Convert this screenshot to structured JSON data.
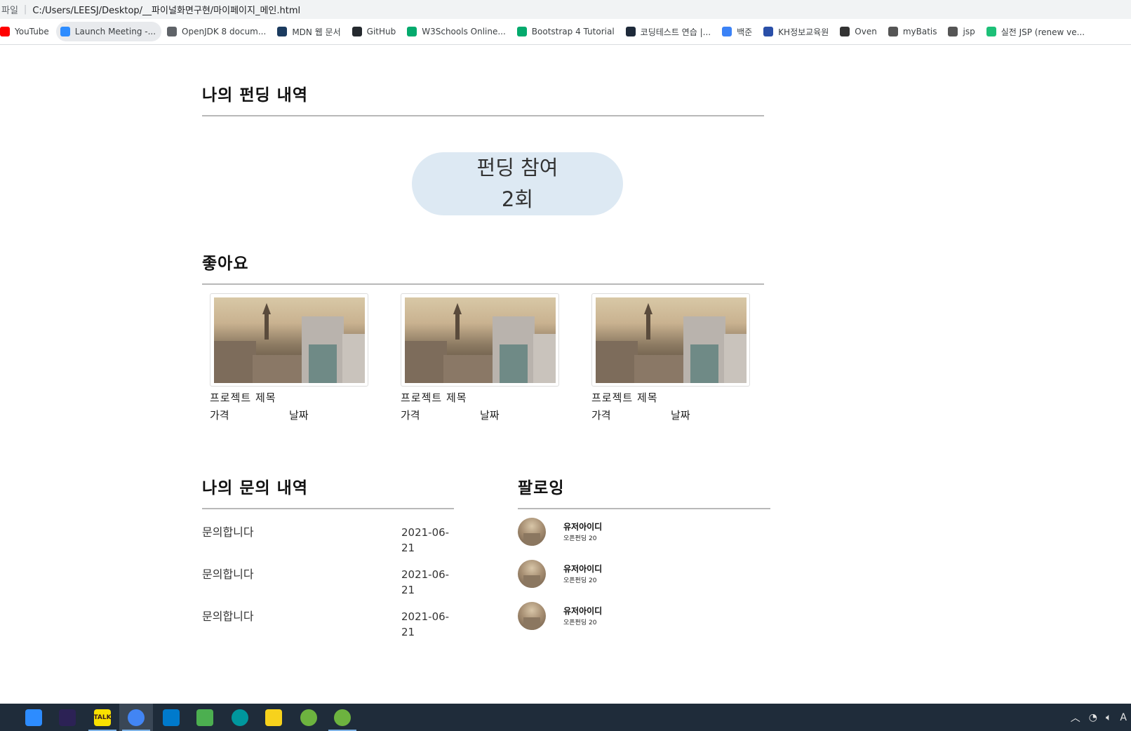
{
  "browser": {
    "address_scheme": "파일",
    "address_path": "C:/Users/LEESJ/Desktop/__파이널화면구현/마이페이지_메인.html",
    "bookmarks": [
      {
        "label": "YouTube",
        "icon": "youtube-icon",
        "color": "#ff0000"
      },
      {
        "label": "Launch Meeting -...",
        "icon": "zoom-icon",
        "color": "#2d8cff"
      },
      {
        "label": "OpenJDK 8 docum...",
        "icon": "search-doc-icon",
        "color": "#5f6368"
      },
      {
        "label": "MDN 웹 문서",
        "icon": "mdn-icon",
        "color": "#1b3b5f"
      },
      {
        "label": "GitHub",
        "icon": "github-icon",
        "color": "#24292e"
      },
      {
        "label": "W3Schools Online...",
        "icon": "w3schools-icon",
        "color": "#04aa6d"
      },
      {
        "label": "Bootstrap 4 Tutorial",
        "icon": "w3schools-icon",
        "color": "#04aa6d"
      },
      {
        "label": "코딩테스트 연습 |...",
        "icon": "programmers-icon",
        "color": "#1e2a3a"
      },
      {
        "label": "백준",
        "icon": "code-icon",
        "color": "#3b82f6"
      },
      {
        "label": "KH정보교육원",
        "icon": "kh-icon",
        "color": "#2a4fa8"
      },
      {
        "label": "Oven",
        "icon": "oven-icon",
        "color": "#333333"
      },
      {
        "label": "myBatis",
        "icon": "globe-icon",
        "color": "#555555"
      },
      {
        "label": "jsp",
        "icon": "globe-icon",
        "color": "#555555"
      },
      {
        "label": "실전 JSP (renew ve...",
        "icon": "inflearn-icon",
        "color": "#1dc078"
      }
    ]
  },
  "page": {
    "funding_title": "나의 펀딩 내역",
    "funding_pill": {
      "line1": "펀딩 참여",
      "line2": "2회"
    },
    "likes_title": "좋아요",
    "cards": [
      {
        "title": "프로젝트 제목",
        "price": "가격",
        "date": "날짜"
      },
      {
        "title": "프로젝트 제목",
        "price": "가격",
        "date": "날짜"
      },
      {
        "title": "프로젝트 제목",
        "price": "가격",
        "date": "날짜"
      }
    ],
    "inquiry_title": "나의 문의 내역",
    "inquiries": [
      {
        "text": "문의합니다",
        "date": "2021-06-21"
      },
      {
        "text": "문의합니다",
        "date": "2021-06-21"
      },
      {
        "text": "문의합니다",
        "date": "2021-06-21"
      }
    ],
    "following_title": "팔로잉",
    "following": [
      {
        "user_id": "유저아이디",
        "sub": "오픈펀딩 20"
      },
      {
        "user_id": "유저아이디",
        "sub": "오픈펀딩 20"
      },
      {
        "user_id": "유저아이디",
        "sub": "오픈펀딩 20"
      }
    ]
  },
  "taskbar": {
    "apps": [
      {
        "name": "zoom",
        "icon": "zoom-icon",
        "color": "#2d8cff"
      },
      {
        "name": "eclipse",
        "icon": "eclipse-icon",
        "color": "#2c2255"
      },
      {
        "name": "kakaotalk",
        "icon": "kakaotalk-icon",
        "color": "#fae100",
        "label": "TALK"
      },
      {
        "name": "chrome",
        "icon": "chrome-icon",
        "color": "#4285f4"
      },
      {
        "name": "vscode",
        "icon": "vscode-icon",
        "color": "#007acc"
      },
      {
        "name": "media",
        "icon": "media-icon",
        "color": "#4caf50"
      },
      {
        "name": "arduino",
        "icon": "arduino-icon",
        "color": "#00979d"
      },
      {
        "name": "sticky-notes",
        "icon": "sticky-notes-icon",
        "color": "#f7d21c"
      },
      {
        "name": "spring",
        "icon": "spring-icon",
        "color": "#6db33f"
      },
      {
        "name": "spring",
        "icon": "spring-icon",
        "color": "#6db33f"
      }
    ],
    "tray_ime": "A"
  }
}
